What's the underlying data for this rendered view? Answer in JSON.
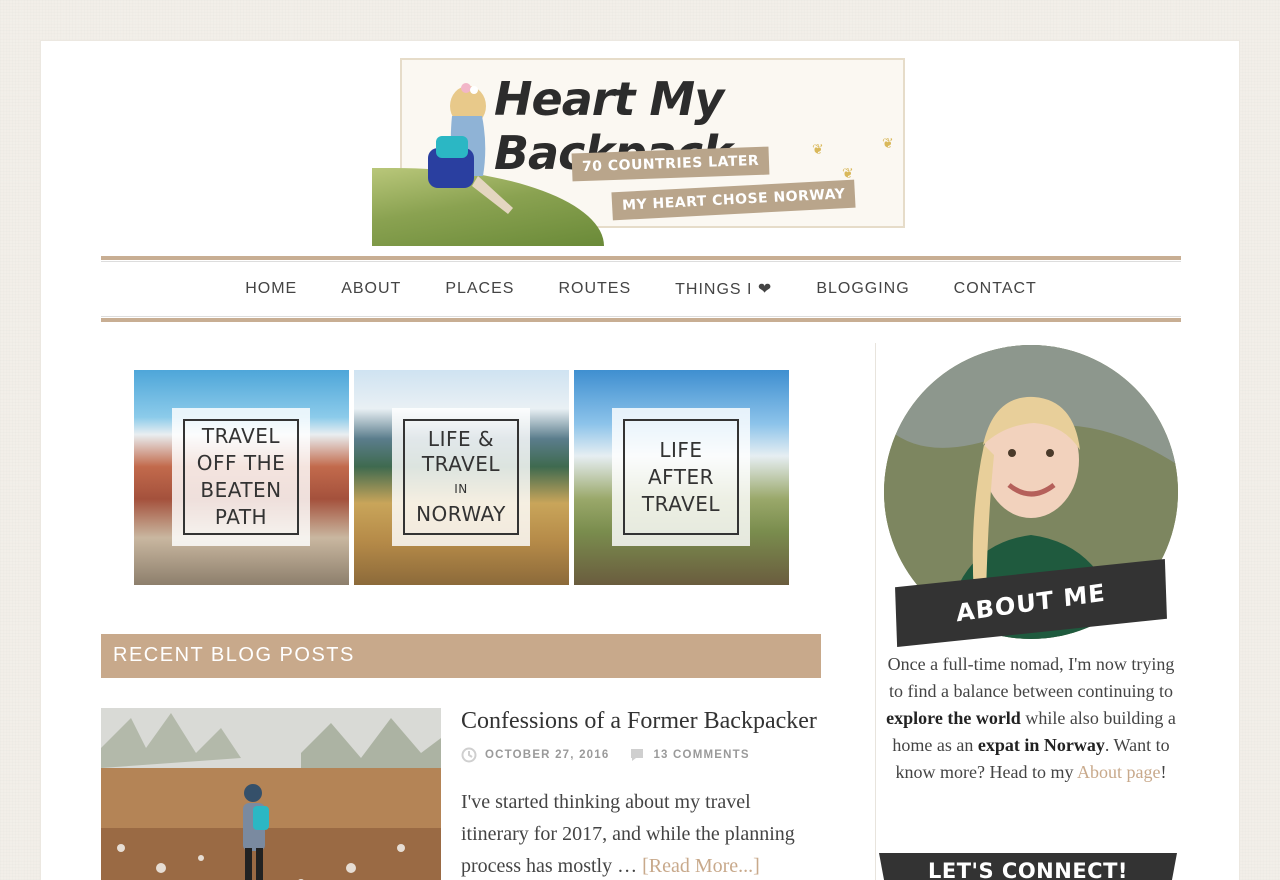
{
  "header": {
    "title": "Heart My Backpack",
    "tagline1": "70 COUNTRIES LATER",
    "tagline2": "MY HEART CHOSE NORWAY"
  },
  "nav": {
    "items": [
      "HOME",
      "ABOUT",
      "PLACES",
      "ROUTES",
      "THINGS I ❤",
      "BLOGGING",
      "CONTACT"
    ]
  },
  "tiles": [
    {
      "label": "TRAVEL\nOFF THE\nBEATEN\nPATH"
    },
    {
      "label_a": "LIFE &",
      "label_b": "TRAVEL",
      "label_c": "IN",
      "label_d": "NORWAY"
    },
    {
      "label": "LIFE\nAFTER\nTRAVEL"
    }
  ],
  "recent": {
    "heading": "RECENT BLOG POSTS"
  },
  "post": {
    "title": "Confessions of a Former Backpacker",
    "date": "OCTOBER 27, 2016",
    "comments": "13 COMMENTS",
    "excerpt": "I've started thinking about my travel itinerary for 2017, and while the planning process has mostly …",
    "read_more": "[Read More...]"
  },
  "sidebar": {
    "about_heading": "ABOUT ME",
    "about_p1": "Once a full-time nomad, I'm now trying to find a balance between continuing to ",
    "about_b1": "explore the world",
    "about_p2": " while also building a home as an ",
    "about_b2": "expat in Norway",
    "about_p3": ". Want to know more? Head to my ",
    "about_link": "About page",
    "about_p4": "!",
    "connect_heading": "LET'S CONNECT!"
  },
  "colors": {
    "accent": "#c8a98b",
    "dark": "#333333"
  }
}
